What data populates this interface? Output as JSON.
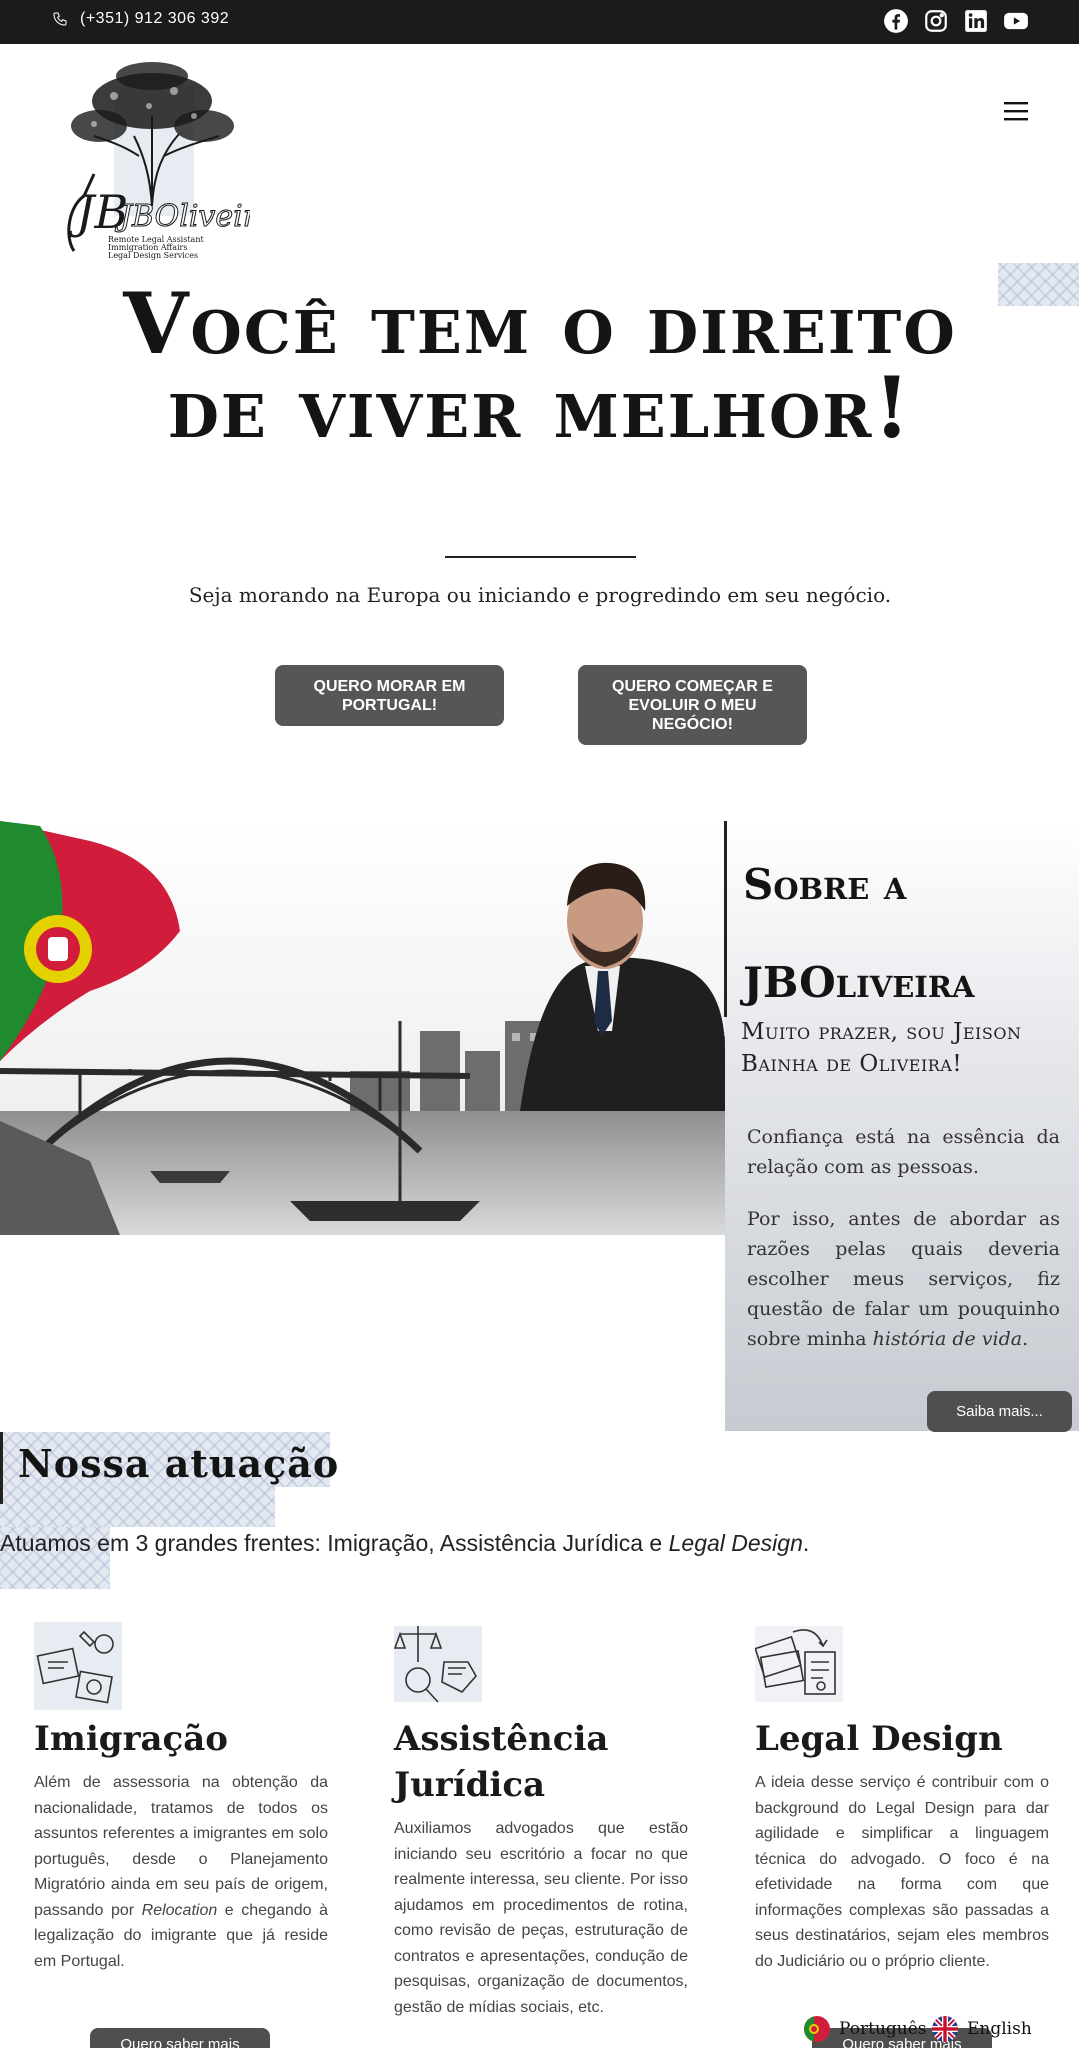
{
  "topbar": {
    "phone": "(+351) 912 306 392",
    "socials": [
      "facebook-icon",
      "instagram-icon",
      "linkedin-icon",
      "youtube-icon"
    ]
  },
  "logo": {
    "name": "JBOliveira",
    "tagline": [
      "Remote Legal Assistant",
      "Immigration Affairs",
      "Legal Design Services"
    ]
  },
  "hero": {
    "title": "Você tem o direito de viver melhor!",
    "subtitle": "Seja morando na Europa ou iniciando e progredindo em seu negócio.",
    "button_left": "QUERO MORAR EM PORTUGAL!",
    "button_right": "QUERO COMEÇAR E EVOLUIR O MEU NEGÓCIO!"
  },
  "about": {
    "title_line1": "Sobre a",
    "title_line2": "JBOliveira",
    "subtitle": "Muito prazer, sou Jeison Bainha de Oliveira!",
    "paragraph1": "Confiança está na essência da relação com as pessoas.",
    "paragraph2_main": "Por isso, antes de abordar as razões pelas quais deveria escolher meus serviços, fiz questão de falar um pouquinho sobre minha ",
    "paragraph2_italic": "história de vida",
    "paragraph2_end": ".",
    "button": "Saiba mais..."
  },
  "atuacao": {
    "title": "Nossa atuação",
    "subtitle_main": "Atuamos em 3 grandes frentes: Imigração, Assistência Jurídica e ",
    "subtitle_italic": "Legal Design",
    "subtitle_end": ".",
    "columns": [
      {
        "icon": "passport-icon",
        "title": "Imigração",
        "text_before": "Além de assessoria na obtenção da nacionalidade, tratamos de todos os assuntos referentes a imigrantes em solo português, desde o Planejamento Migratório ainda em seu país de origem, passando por ",
        "text_italic": "Relocation",
        "text_after": " e chegando à legalização do imigrante que já reside em Portugal.",
        "button": "Quero saber mais"
      },
      {
        "icon": "scales-icon",
        "title": "Assistência Jurídica",
        "text": "Auxiliamos advogados que estão iniciando seu escritório a focar no que realmente interessa, seu cliente. Por isso ajudamos em procedimentos de rotina, como revisão de peças, estruturação de contratos e apresentações, condução de pesquisas, organização de documentos, gestão de mídias sociais, etc."
      },
      {
        "icon": "documents-icon",
        "title": "Legal Design",
        "text": "A ideia desse serviço é contribuir com o background do Legal Design para dar agilidade e simplificar a linguagem técnica do advogado. O foco é na efetividade na forma com que informações complexas são passadas a seus destinatários, sejam eles membros do Judiciário ou o próprio cliente.",
        "button": "Quero saber mais"
      }
    ]
  },
  "language": {
    "pt": "Português",
    "en": "English"
  },
  "colors": {
    "topbar": "#1b1b1b",
    "button": "#565656",
    "text": "#1a1a1a"
  }
}
